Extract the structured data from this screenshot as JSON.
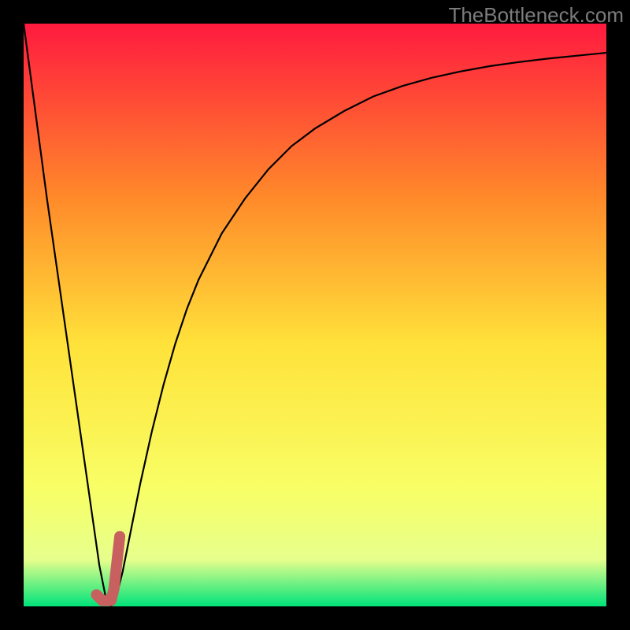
{
  "watermark": "TheBottleneck.com",
  "colors": {
    "frame": "#000000",
    "gradient_top": "#ff1a3f",
    "gradient_mid_upper": "#ff8a2a",
    "gradient_mid": "#ffe23a",
    "gradient_lower": "#f8ff66",
    "gradient_near_bottom": "#e6ff8c",
    "gradient_bottom": "#00e37a",
    "curve": "#000000",
    "marker": "#c86060"
  },
  "chart_data": {
    "type": "line",
    "title": "",
    "xlabel": "",
    "ylabel": "",
    "xlim": [
      0,
      100
    ],
    "ylim": [
      0,
      100
    ],
    "series": [
      {
        "name": "bottleneck-v-curve",
        "x": [
          0,
          2,
          4,
          6,
          8,
          10,
          12,
          13,
          14,
          15,
          16,
          17,
          18,
          20,
          22,
          24,
          26,
          28,
          30,
          34,
          38,
          42,
          46,
          50,
          55,
          60,
          65,
          70,
          75,
          80,
          85,
          90,
          95,
          100
        ],
        "y": [
          100,
          85,
          70,
          56,
          42,
          28,
          14,
          7,
          2,
          0,
          2,
          6,
          11,
          21,
          30,
          38,
          45,
          51,
          56,
          64,
          70,
          75,
          79,
          82,
          85,
          87.5,
          89.3,
          90.7,
          91.8,
          92.7,
          93.4,
          94,
          94.5,
          95
        ]
      }
    ],
    "marker": {
      "name": "selected-point",
      "path_xy": [
        [
          16.5,
          12
        ],
        [
          15.5,
          3
        ],
        [
          15,
          1
        ],
        [
          13.5,
          1
        ],
        [
          12.5,
          2
        ]
      ]
    }
  }
}
